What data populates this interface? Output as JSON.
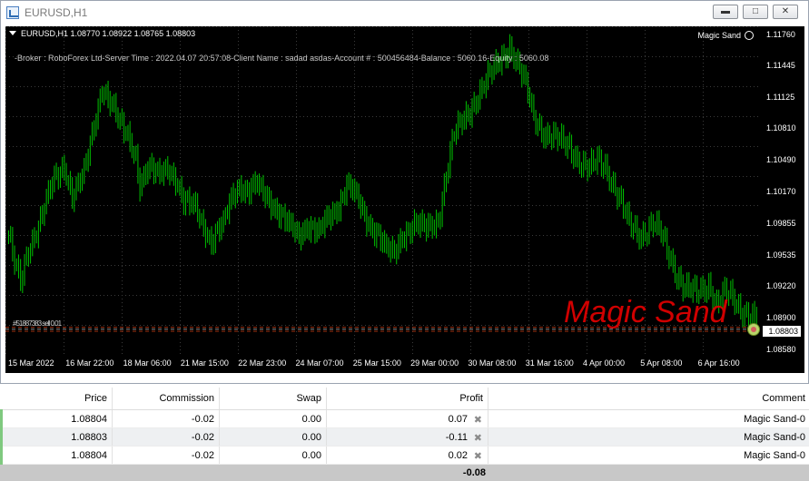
{
  "window": {
    "title": "EURUSD,H1",
    "buttons": [
      "minimize",
      "maximize",
      "close"
    ]
  },
  "chart": {
    "symbol_info": "EURUSD,H1  1.08770 1.08922 1.08765 1.08803",
    "ea_name": "Magic Sand",
    "ea_status_icon": "smiley-icon",
    "info_line": "-Broker : RoboForex Ltd-Server Time : 2022.04.07 20:57:08-Client Name    : sadad asdas-Account # : 500456484-Balance : 5060.16-Equity    : 5060.08",
    "watermark": "Magic Sand",
    "order_labels": "#51887383 sell 0.01",
    "current_price": "1.08803",
    "colors": {
      "background": "#000000",
      "candles": "#00c000",
      "grid": "#3a3a3a",
      "watermark": "#d00000",
      "order_line": "#a03010"
    }
  },
  "chart_data": {
    "type": "bar",
    "title": "EURUSD,H1",
    "ohlc_last": {
      "open": 1.0877,
      "high": 1.08922,
      "low": 1.08765,
      "close": 1.08803
    },
    "y_ticks": [
      "1.11760",
      "1.11445",
      "1.11125",
      "1.10810",
      "1.10490",
      "1.10170",
      "1.09855",
      "1.09535",
      "1.09220",
      "1.08900",
      "1.08803",
      "1.08580"
    ],
    "x_ticks": [
      "15 Mar 2022",
      "16 Mar 22:00",
      "18 Mar 06:00",
      "21 Mar 15:00",
      "22 Mar 23:00",
      "24 Mar 07:00",
      "25 Mar 15:00",
      "29 Mar 00:00",
      "30 Mar 08:00",
      "31 Mar 16:00",
      "4 Apr 00:00",
      "5 Apr 08:00",
      "6 Apr 16:00"
    ],
    "ylim": [
      1.0855,
      1.1185
    ],
    "close_path": [
      [
        0,
        1.0975
      ],
      [
        3,
        1.0945
      ],
      [
        6,
        1.0925
      ],
      [
        10,
        1.096
      ],
      [
        15,
        1.0985
      ],
      [
        22,
        1.1025
      ],
      [
        28,
        1.1045
      ],
      [
        32,
        1.1015
      ],
      [
        38,
        1.1035
      ],
      [
        44,
        1.1095
      ],
      [
        47,
        1.1125
      ],
      [
        52,
        1.1105
      ],
      [
        56,
        1.1085
      ],
      [
        60,
        1.1075
      ],
      [
        64,
        1.1055
      ],
      [
        66,
        1.1025
      ],
      [
        70,
        1.104
      ],
      [
        75,
        1.1035
      ],
      [
        80,
        1.1045
      ],
      [
        84,
        1.103
      ],
      [
        88,
        1.1005
      ],
      [
        94,
        1.1005
      ],
      [
        98,
        1.0985
      ],
      [
        102,
        1.0965
      ],
      [
        108,
        1.0985
      ],
      [
        112,
        1.1015
      ],
      [
        116,
        1.1025
      ],
      [
        120,
        1.1015
      ],
      [
        125,
        1.1025
      ],
      [
        130,
        1.1015
      ],
      [
        136,
        1.0995
      ],
      [
        140,
        1.0985
      ],
      [
        146,
        1.0975
      ],
      [
        150,
        1.0985
      ],
      [
        156,
        1.0975
      ],
      [
        160,
        1.099
      ],
      [
        166,
        1.1005
      ],
      [
        170,
        1.1025
      ],
      [
        174,
        1.1015
      ],
      [
        180,
        1.099
      ],
      [
        186,
        1.0975
      ],
      [
        190,
        1.0958
      ],
      [
        194,
        1.0955
      ],
      [
        198,
        1.0975
      ],
      [
        204,
        1.0985
      ],
      [
        210,
        1.098
      ],
      [
        216,
        1.099
      ],
      [
        220,
        1.1035
      ],
      [
        224,
        1.1075
      ],
      [
        230,
        1.1095
      ],
      [
        236,
        1.1115
      ],
      [
        242,
        1.1135
      ],
      [
        248,
        1.1155
      ],
      [
        252,
        1.1165
      ],
      [
        256,
        1.1145
      ],
      [
        260,
        1.1125
      ],
      [
        264,
        1.1095
      ],
      [
        270,
        1.1075
      ],
      [
        276,
        1.107
      ],
      [
        282,
        1.1065
      ],
      [
        288,
        1.1045
      ],
      [
        292,
        1.104
      ],
      [
        296,
        1.105
      ],
      [
        300,
        1.1045
      ],
      [
        304,
        1.1025
      ],
      [
        308,
        1.1005
      ],
      [
        312,
        1.0985
      ],
      [
        318,
        1.0975
      ],
      [
        324,
        1.0985
      ],
      [
        328,
        1.0975
      ],
      [
        332,
        1.0955
      ],
      [
        336,
        1.0935
      ],
      [
        340,
        1.092
      ],
      [
        346,
        1.0915
      ],
      [
        352,
        1.0925
      ],
      [
        356,
        1.0905
      ],
      [
        360,
        1.0915
      ],
      [
        364,
        1.091
      ],
      [
        368,
        1.09
      ],
      [
        372,
        1.0895
      ],
      [
        376,
        1.0888
      ]
    ]
  },
  "orders_table": {
    "columns": [
      "Price",
      "Commission",
      "Swap",
      "Profit",
      "Comment"
    ],
    "rows": [
      {
        "price": "1.08804",
        "commission": "-0.02",
        "swap": "0.00",
        "profit": "0.07",
        "comment": "Magic Sand-0"
      },
      {
        "price": "1.08803",
        "commission": "-0.02",
        "swap": "0.00",
        "profit": "-0.11",
        "comment": "Magic Sand-0"
      },
      {
        "price": "1.08804",
        "commission": "-0.02",
        "swap": "0.00",
        "profit": "0.02",
        "comment": "Magic Sand-0"
      }
    ],
    "close_icon": "close-x-icon",
    "total_profit": "-0.08"
  }
}
